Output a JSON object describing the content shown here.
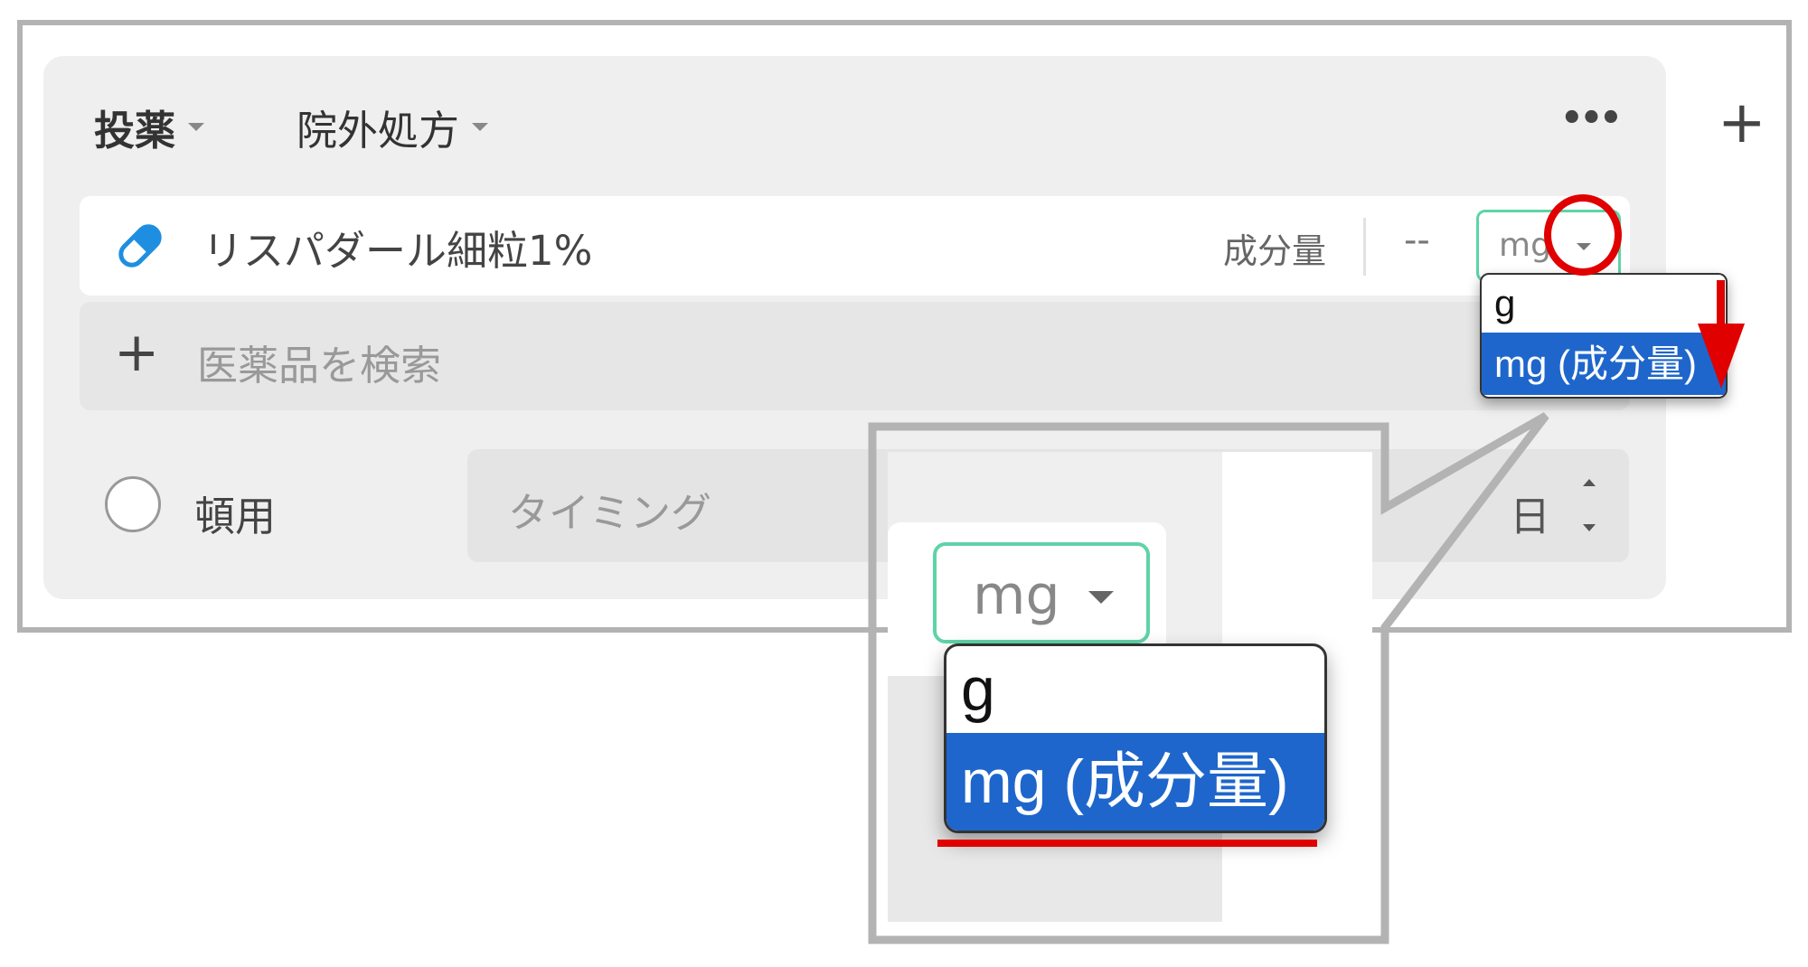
{
  "header": {
    "title": "投薬",
    "prescription_type": "院外処方",
    "more_label": "•••",
    "add_label": "+"
  },
  "drug_row": {
    "name": "リスパダール細粒1%",
    "component_label": "成分量",
    "amount_placeholder": "--",
    "unit_value": "mg"
  },
  "search": {
    "add_label": "+",
    "placeholder": "医薬品を検索"
  },
  "bottom_row": {
    "prn_label": "頓用",
    "timing_placeholder": "タイミング",
    "day_unit": "日"
  },
  "unit_dropdown": {
    "options": [
      "g",
      "mg (成分量)"
    ],
    "selected_index": 1
  },
  "zoom": {
    "unit_value": "mg",
    "options": [
      "g",
      "mg (成分量)"
    ]
  },
  "colors": {
    "accent_green": "#5fd3a8",
    "selection_blue": "#1e66cc",
    "annotation_red": "#e00000",
    "pill_blue": "#1e8fe0"
  }
}
